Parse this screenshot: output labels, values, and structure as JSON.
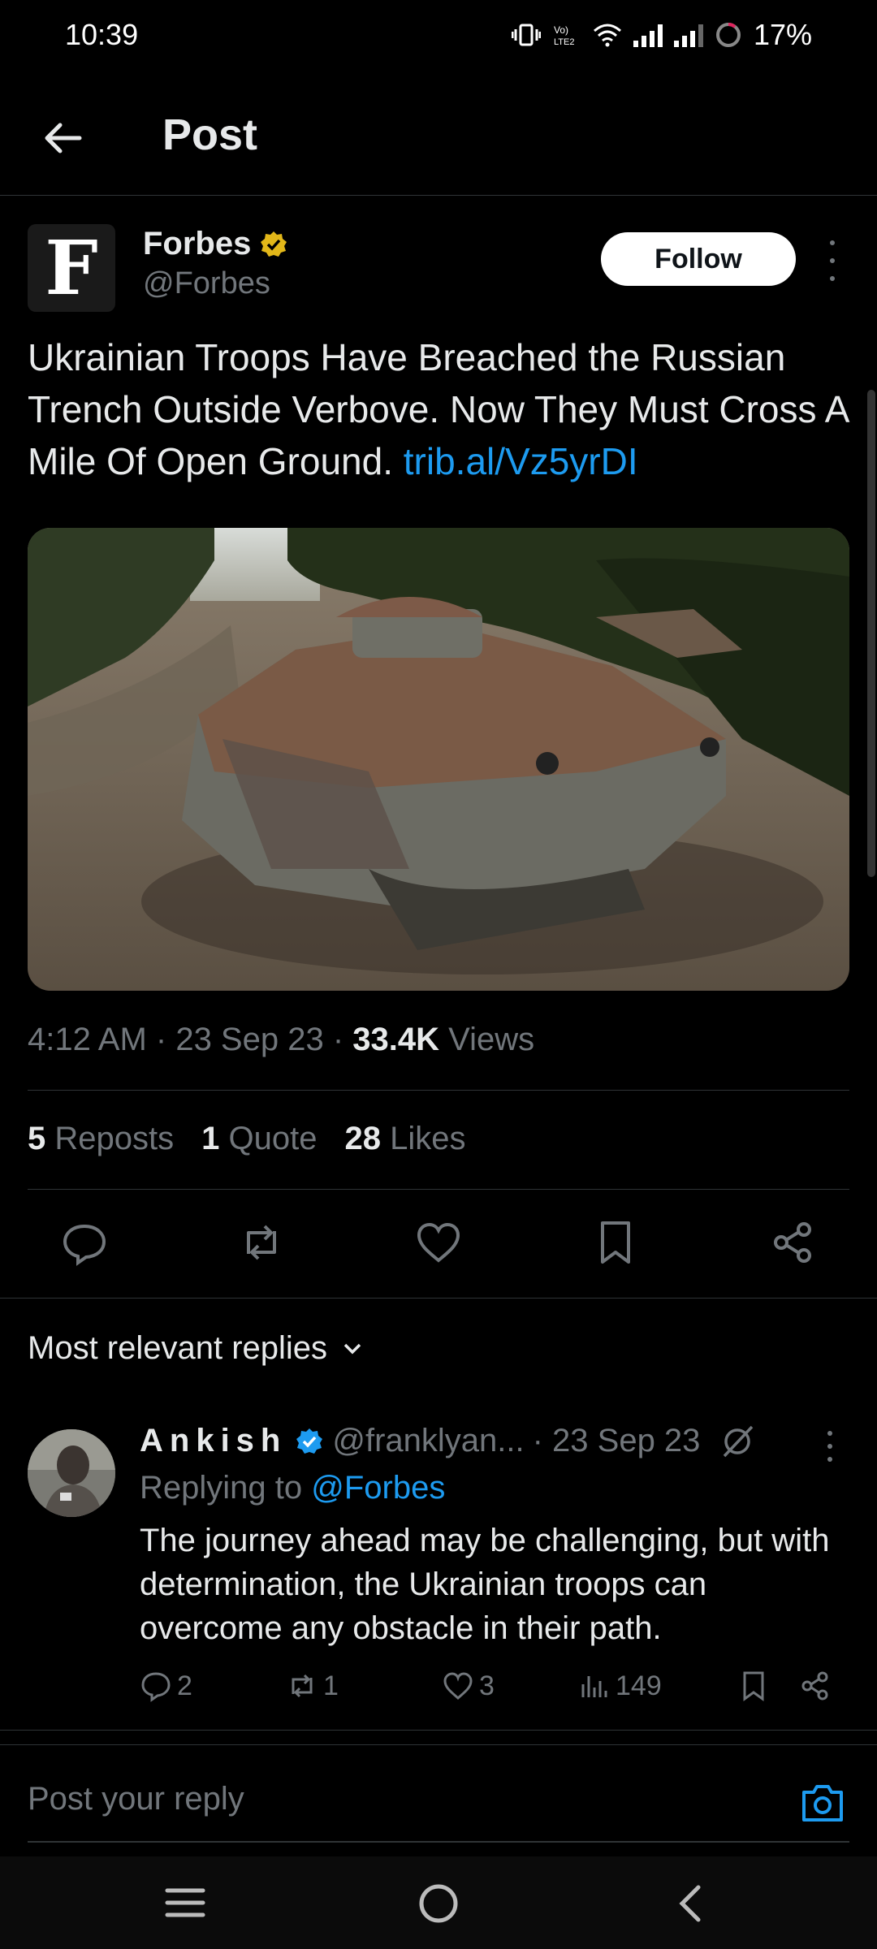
{
  "status_bar": {
    "time": "10:39",
    "battery": "17%"
  },
  "header": {
    "title": "Post"
  },
  "post": {
    "avatar_letter": "F",
    "author_name": "Forbes",
    "author_handle": "@Forbes",
    "follow_label": "Follow",
    "text": "Ukrainian Troops Have Breached the Russian Trench Outside Verbove. Now They Must Cross A Mile Of Open Ground.",
    "link": "trib.al/Vz5yrDI",
    "time": "4:12 AM",
    "date": "23 Sep 23",
    "views_count": "33.4K",
    "views_label": "Views",
    "reposts_count": "5",
    "reposts_label": "Reposts",
    "quotes_count": "1",
    "quotes_label": "Quote",
    "likes_count": "28",
    "likes_label": "Likes"
  },
  "replies": {
    "sort_label": "Most relevant replies",
    "items": [
      {
        "name": "Ankish",
        "handle": "@franklyan...",
        "date": "· 23 Sep 23",
        "replying_prefix": "Replying to",
        "replying_to": "@Forbes",
        "text": "The journey ahead may be challenging, but with determination, the Ukrainian troops can overcome any obstacle in their path.",
        "reply_count": "2",
        "repost_count": "1",
        "like_count": "3",
        "view_count": "149"
      }
    ]
  },
  "compose": {
    "placeholder": "Post your reply"
  },
  "colors": {
    "background": "#000000",
    "accent": "#1d9bf0",
    "verified_gold": "#e2b719",
    "muted": "#71767b"
  }
}
